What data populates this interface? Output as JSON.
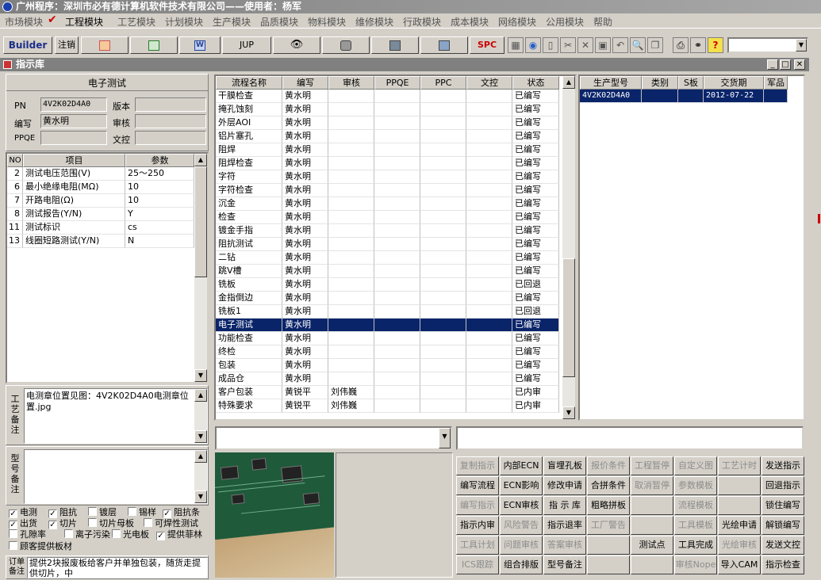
{
  "window": {
    "title": "广州程序：深圳市必有德计算机软件技术有限公司——使用者：杨军",
    "subtitle": "指示库"
  },
  "menu": [
    "市场模块",
    "工程模块",
    "工艺模块",
    "计划模块",
    "生产模块",
    "品质模块",
    "物料模块",
    "维修模块",
    "行政模块",
    "成本模块",
    "网络模块",
    "公用模块",
    "帮助"
  ],
  "menu_active": "工程模块",
  "toolbar": {
    "builder": "Builder",
    "logout": "注销",
    "jup": "JUP",
    "spc": "SPC"
  },
  "form": {
    "section_title": "电子测试",
    "pn_label": "PN",
    "pn_value": "4V2K02D4A0",
    "version_label": "版本",
    "version_value": "",
    "editor_label": "编写",
    "editor_value": "黄水明",
    "review_label": "审核",
    "review_value": "",
    "ppqe_label": "PPQE",
    "ppqe_value": "",
    "doc_label": "文控",
    "doc_value": ""
  },
  "params": {
    "headers": [
      "NO",
      "项目",
      "参数"
    ],
    "rows": [
      {
        "no": "2",
        "item": "测试电压范围(V)",
        "value": "25～250"
      },
      {
        "no": "6",
        "item": "最小绝缘电阻(MΩ)",
        "value": "10"
      },
      {
        "no": "7",
        "item": "开路电阻(Ω)",
        "value": "10"
      },
      {
        "no": "8",
        "item": "测试报告(Y/N)",
        "value": "Y"
      },
      {
        "no": "11",
        "item": "测试标识",
        "value": "cs"
      },
      {
        "no": "13",
        "item": "线圈短路测试(Y/N)",
        "value": "N"
      }
    ]
  },
  "craft_note": {
    "label": "工艺备注",
    "text": "电测章位置见图：4V2K02D4A0电测章位置.jpg"
  },
  "model_note": {
    "label": "型号备注",
    "text": ""
  },
  "checkboxes": [
    {
      "label": "电测",
      "checked": true
    },
    {
      "label": "阻抗",
      "checked": true
    },
    {
      "label": "镀层",
      "checked": false
    },
    {
      "label": "锡样",
      "checked": false
    },
    {
      "label": "阻抗条",
      "checked": true
    },
    {
      "label": "出货",
      "checked": true
    },
    {
      "label": "切片",
      "checked": true
    },
    {
      "label": "切片母板",
      "checked": false
    },
    {
      "label": "可焊性测试",
      "checked": false
    },
    {
      "label": "孔隙率",
      "checked": false
    },
    {
      "label": "离子污染",
      "checked": false
    },
    {
      "label": "光电板",
      "checked": false
    },
    {
      "label": "提供菲林",
      "checked": true
    },
    {
      "label": "顾客提供板材",
      "checked": false
    }
  ],
  "order_note": {
    "label": "订单备注",
    "text": "提供2块报废板给客户并单独包装，随货走提供切片，中"
  },
  "process": {
    "headers": [
      "流程名称",
      "编写",
      "审核",
      "PPQE",
      "PPC",
      "文控",
      "状态"
    ],
    "selected_index": 17,
    "rows": [
      {
        "name": "干膜检查",
        "editor": "黄水明",
        "reviewer": "",
        "status": "已编写"
      },
      {
        "name": "掩孔蚀刻",
        "editor": "黄水明",
        "reviewer": "",
        "status": "已编写"
      },
      {
        "name": "外层AOI",
        "editor": "黄水明",
        "reviewer": "",
        "status": "已编写"
      },
      {
        "name": "铝片塞孔",
        "editor": "黄水明",
        "reviewer": "",
        "status": "已编写"
      },
      {
        "name": "阻焊",
        "editor": "黄水明",
        "reviewer": "",
        "status": "已编写"
      },
      {
        "name": "阻焊检查",
        "editor": "黄水明",
        "reviewer": "",
        "status": "已编写"
      },
      {
        "name": "字符",
        "editor": "黄水明",
        "reviewer": "",
        "status": "已编写"
      },
      {
        "name": "字符检查",
        "editor": "黄水明",
        "reviewer": "",
        "status": "已编写"
      },
      {
        "name": "沉金",
        "editor": "黄水明",
        "reviewer": "",
        "status": "已编写"
      },
      {
        "name": "检查",
        "editor": "黄水明",
        "reviewer": "",
        "status": "已编写"
      },
      {
        "name": "镀金手指",
        "editor": "黄水明",
        "reviewer": "",
        "status": "已编写"
      },
      {
        "name": "阻抗测试",
        "editor": "黄水明",
        "reviewer": "",
        "status": "已编写"
      },
      {
        "name": "二钻",
        "editor": "黄水明",
        "reviewer": "",
        "status": "已编写"
      },
      {
        "name": "跳V槽",
        "editor": "黄水明",
        "reviewer": "",
        "status": "已编写"
      },
      {
        "name": "铣板",
        "editor": "黄水明",
        "reviewer": "",
        "status": "已回退"
      },
      {
        "name": "金指倒边",
        "editor": "黄水明",
        "reviewer": "",
        "status": "已编写"
      },
      {
        "name": "铣板1",
        "editor": "黄水明",
        "reviewer": "",
        "status": "已回退"
      },
      {
        "name": "电子测试",
        "editor": "黄水明",
        "reviewer": "",
        "status": "已编写"
      },
      {
        "name": "功能检查",
        "editor": "黄水明",
        "reviewer": "",
        "status": "已编写"
      },
      {
        "name": "终检",
        "editor": "黄水明",
        "reviewer": "",
        "status": "已编写"
      },
      {
        "name": "包装",
        "editor": "黄水明",
        "reviewer": "",
        "status": "已编写"
      },
      {
        "name": "成品仓",
        "editor": "黄水明",
        "reviewer": "",
        "status": "已编写"
      },
      {
        "name": "客户包装",
        "editor": "黄锐平",
        "reviewer": "刘伟巍",
        "status": "已内审"
      },
      {
        "name": "特殊要求",
        "editor": "黄锐平",
        "reviewer": "刘伟巍",
        "status": "已内审"
      }
    ]
  },
  "products": {
    "headers": [
      "生产型号",
      "类别",
      "S板",
      "交货期",
      "军品"
    ],
    "rows": [
      {
        "model": "4V2K02D4A0",
        "category": "",
        "s": "",
        "due": "2012-07-22",
        "mil": ""
      }
    ]
  },
  "buttons": [
    {
      "label": "复制指示",
      "enabled": false
    },
    {
      "label": "内部ECN",
      "enabled": true
    },
    {
      "label": "盲埋孔板",
      "enabled": true
    },
    {
      "label": "报价条件",
      "enabled": false
    },
    {
      "label": "工程暂停",
      "enabled": false
    },
    {
      "label": "自定义图",
      "enabled": false
    },
    {
      "label": "工艺计时",
      "enabled": false
    },
    {
      "label": "发送指示",
      "enabled": true
    },
    {
      "label": "编写流程",
      "enabled": true
    },
    {
      "label": "ECN影响",
      "enabled": true
    },
    {
      "label": "修改申请",
      "enabled": true
    },
    {
      "label": "合拼条件",
      "enabled": true
    },
    {
      "label": "取消暂停",
      "enabled": false
    },
    {
      "label": "参数模板",
      "enabled": false
    },
    {
      "label": "",
      "enabled": false
    },
    {
      "label": "回退指示",
      "enabled": true
    },
    {
      "label": "编写指示",
      "enabled": false
    },
    {
      "label": "ECN审核",
      "enabled": true
    },
    {
      "label": "指 示 库",
      "enabled": true
    },
    {
      "label": "粗略拼板",
      "enabled": true
    },
    {
      "label": "",
      "enabled": false
    },
    {
      "label": "流程模板",
      "enabled": false
    },
    {
      "label": "",
      "enabled": false
    },
    {
      "label": "锁住编写",
      "enabled": true
    },
    {
      "label": "指示内审",
      "enabled": true
    },
    {
      "label": "风险警告",
      "enabled": false
    },
    {
      "label": "指示退率",
      "enabled": true
    },
    {
      "label": "工厂警告",
      "enabled": false
    },
    {
      "label": "",
      "enabled": false
    },
    {
      "label": "工具模板",
      "enabled": false
    },
    {
      "label": "光绘申请",
      "enabled": true
    },
    {
      "label": "解锁编写",
      "enabled": true
    },
    {
      "label": "工具计划",
      "enabled": false
    },
    {
      "label": "问题审核",
      "enabled": false
    },
    {
      "label": "答案审核",
      "enabled": false
    },
    {
      "label": "",
      "enabled": false
    },
    {
      "label": "测试点",
      "enabled": true
    },
    {
      "label": "工具完成",
      "enabled": true
    },
    {
      "label": "光绘审核",
      "enabled": false
    },
    {
      "label": "发送文控",
      "enabled": true
    },
    {
      "label": "ICS跟踪",
      "enabled": false
    },
    {
      "label": "组合排版",
      "enabled": true
    },
    {
      "label": "型号备注",
      "enabled": true
    },
    {
      "label": "",
      "enabled": false
    },
    {
      "label": "",
      "enabled": false
    },
    {
      "label": "审核Nope",
      "enabled": false
    },
    {
      "label": "导入CAM",
      "enabled": true
    },
    {
      "label": "指示检查",
      "enabled": true
    }
  ],
  "colors": {
    "selection": "#0a246a",
    "face": "#d4d0c8",
    "title_bar": "#808080"
  }
}
